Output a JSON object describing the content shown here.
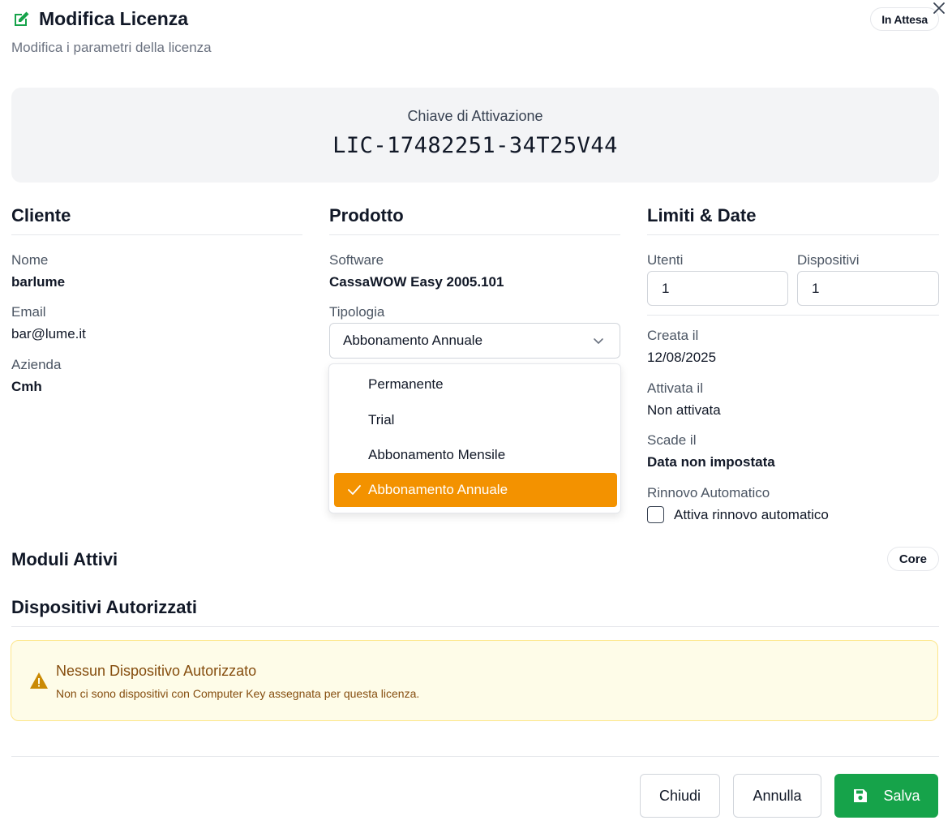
{
  "header": {
    "title": "Modifica Licenza",
    "subtitle": "Modifica i parametri della licenza",
    "status": "In Attesa"
  },
  "activation": {
    "label": "Chiave di Attivazione",
    "key": "LIC-17482251-34T25V44"
  },
  "cliente": {
    "title": "Cliente",
    "nome_label": "Nome",
    "nome": "barlume",
    "email_label": "Email",
    "email": "bar@lume.it",
    "azienda_label": "Azienda",
    "azienda": "Cmh"
  },
  "prodotto": {
    "title": "Prodotto",
    "software_label": "Software",
    "software": "CassaWOW Easy 2005.101",
    "tipologia_label": "Tipologia",
    "tipologia_selected": "Abbonamento Annuale",
    "options": [
      "Permanente",
      "Trial",
      "Abbonamento Mensile",
      "Abbonamento Annuale"
    ]
  },
  "limiti": {
    "title": "Limiti & Date",
    "utenti_label": "Utenti",
    "utenti": "1",
    "dispositivi_label": "Dispositivi",
    "dispositivi": "1",
    "creata_label": "Creata il",
    "creata": "12/08/2025",
    "attivata_label": "Attivata il",
    "attivata": "Non attivata",
    "scade_label": "Scade il",
    "scade": "Data non impostata",
    "rinnovo_label": "Rinnovo Automatico",
    "rinnovo_checkbox": "Attiva rinnovo automatico"
  },
  "moduli": {
    "title": "Moduli Attivi",
    "badge": "Core"
  },
  "dispositivi": {
    "title": "Dispositivi Autorizzati",
    "warning_title": "Nessun Dispositivo Autorizzato",
    "warning_text": "Non ci sono dispositivi con Computer Key assegnata per questa licenza."
  },
  "footer": {
    "chiudi": "Chiudi",
    "annulla": "Annulla",
    "salva": "Salva"
  },
  "colors": {
    "accent_orange": "#f39200",
    "success_green": "#16a34a",
    "warning_bg": "#fefce8"
  }
}
